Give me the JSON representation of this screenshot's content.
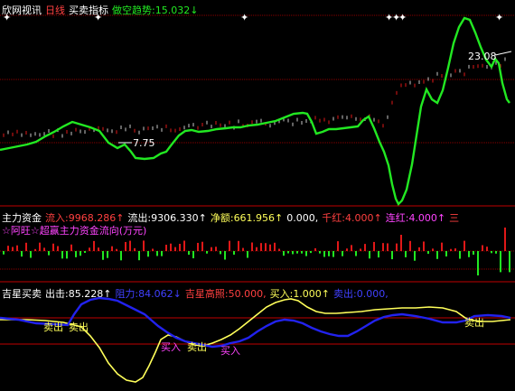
{
  "top_panel": {
    "app_name": "欣网视讯",
    "period": "日线",
    "indicator": "买卖指标",
    "trend_label": "做空趋势:",
    "trend_value": "15.032",
    "trend_arrow": "↓",
    "high_label": "23.08",
    "low_label": "7.75"
  },
  "mid_panel": {
    "name": "主力资金",
    "inflow_label": "流入:",
    "inflow_value": "9968.286↑",
    "outflow_label": "流出:",
    "outflow_value": "9306.330↑",
    "net_label": "净额:",
    "net_value": "661.956↑",
    "zero_value": "0.000,",
    "qianhong_label": "千红:",
    "qianhong_value": "4.000↑",
    "lianhong_label": "连红:",
    "lianhong_value": "4.000↑",
    "tail": "三",
    "subtitle": "☆阿旺☆超赢主力资金流向(万元)"
  },
  "bottom_panel": {
    "name": "吉星买卖",
    "out_label": "出击:",
    "out_value": "85.228↑",
    "resist_label": "阻力:",
    "resist_value": "84.062↓",
    "high_label": "吉星高照:",
    "high_value": "50.000,",
    "buy_label": "买入:",
    "buy_value": "1.000↑",
    "sell_label": "卖出:",
    "sell_value": "0.000,",
    "signals": [
      "卖出",
      "卖出",
      "买入",
      "卖出",
      "买入",
      "卖出"
    ]
  },
  "colors": {
    "green": "#22e822",
    "red": "#e01818",
    "yellow": "#ffff5a",
    "blue": "#2222ee",
    "magenta": "#ff44ff",
    "gray": "#c0c0c0"
  }
}
